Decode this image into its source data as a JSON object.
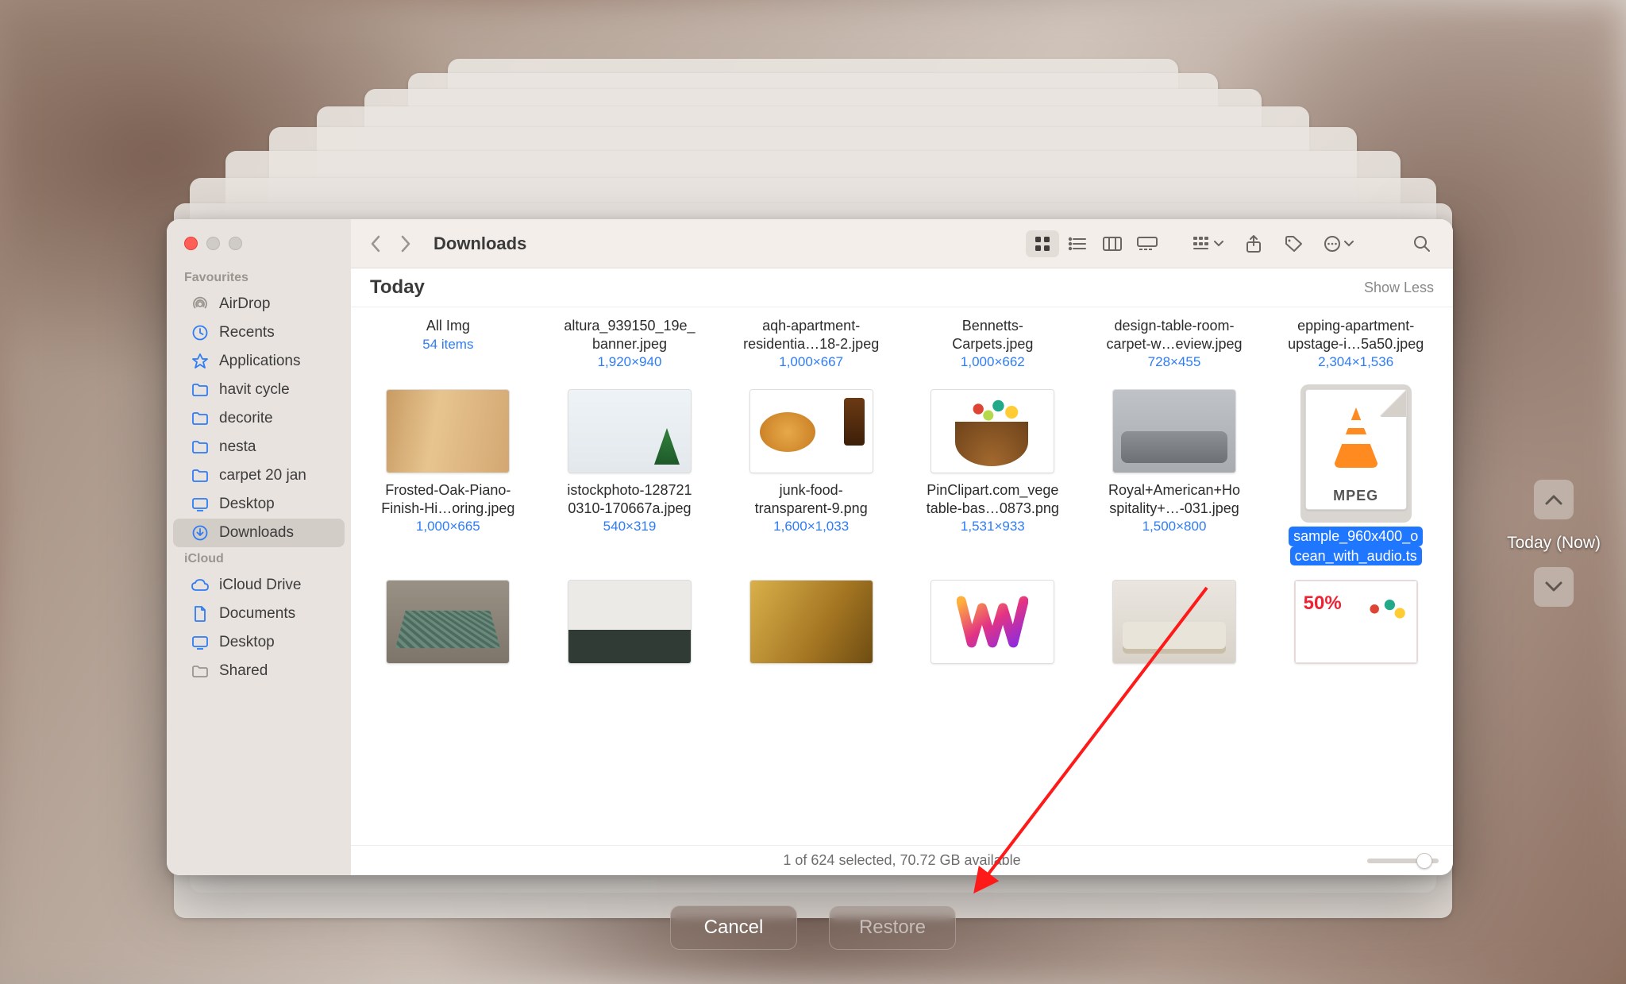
{
  "window_title": "Downloads",
  "sidebar": {
    "sections": [
      {
        "heading": "Favourites",
        "items": [
          {
            "icon": "airdrop",
            "label": "AirDrop",
            "dim": true
          },
          {
            "icon": "clock",
            "label": "Recents"
          },
          {
            "icon": "apps",
            "label": "Applications"
          },
          {
            "icon": "folder",
            "label": "havit cycle"
          },
          {
            "icon": "folder",
            "label": "decorite"
          },
          {
            "icon": "folder",
            "label": "nesta"
          },
          {
            "icon": "folder",
            "label": "carpet 20 jan"
          },
          {
            "icon": "desktop",
            "label": "Desktop"
          },
          {
            "icon": "download",
            "label": "Downloads",
            "active": true
          }
        ]
      },
      {
        "heading": "iCloud",
        "items": [
          {
            "icon": "cloud",
            "label": "iCloud Drive"
          },
          {
            "icon": "doc",
            "label": "Documents"
          },
          {
            "icon": "desktop",
            "label": "Desktop"
          },
          {
            "icon": "shared",
            "label": "Shared",
            "dim": true
          }
        ]
      }
    ]
  },
  "section": {
    "title": "Today",
    "toggle": "Show Less"
  },
  "files": [
    {
      "name1": "All Img",
      "name2": "",
      "dim": "54 items",
      "kind": "folder"
    },
    {
      "name1": "altura_939150_19e_",
      "name2": "banner.jpeg",
      "dim": "1,920×940"
    },
    {
      "name1": "aqh-apartment-",
      "name2": "residentia…18-2.jpeg",
      "dim": "1,000×667"
    },
    {
      "name1": "Bennetts-",
      "name2": "Carpets.jpeg",
      "dim": "1,000×662"
    },
    {
      "name1": "design-table-room-",
      "name2": "carpet-w…eview.jpeg",
      "dim": "728×455"
    },
    {
      "name1": "epping-apartment-",
      "name2": "upstage-i…5a50.jpeg",
      "dim": "2,304×1,536"
    },
    {
      "name1": "Frosted-Oak-Piano-",
      "name2": "Finish-Hi…oring.jpeg",
      "dim": "1,000×665",
      "art": "wood"
    },
    {
      "name1": "istockphoto-128721",
      "name2": "0310-170667a.jpeg",
      "dim": "540×319",
      "art": "xmas"
    },
    {
      "name1": "junk-food-",
      "name2": "transparent-9.png",
      "dim": "1,600×1,033",
      "art": "junk"
    },
    {
      "name1": "PinClipart.com_vege",
      "name2": "table-bas…0873.png",
      "dim": "1,531×933",
      "art": "veg"
    },
    {
      "name1": "Royal+American+Ho",
      "name2": "spitality+…-031.jpeg",
      "dim": "1,500×800",
      "art": "sofa"
    },
    {
      "name1": "sample_960x400_o",
      "name2": "cean_with_audio.ts",
      "dim": "",
      "art": "mpeg",
      "selected": true
    },
    {
      "art": "rug2"
    },
    {
      "art": "livin"
    },
    {
      "art": "gold"
    },
    {
      "art": "w"
    },
    {
      "art": "sofa2"
    },
    {
      "art": "promo"
    }
  ],
  "status": "1 of 624 selected, 70.72 GB available",
  "buttons": {
    "cancel": "Cancel",
    "restore": "Restore"
  },
  "timeline": {
    "label": "Today (Now)"
  }
}
